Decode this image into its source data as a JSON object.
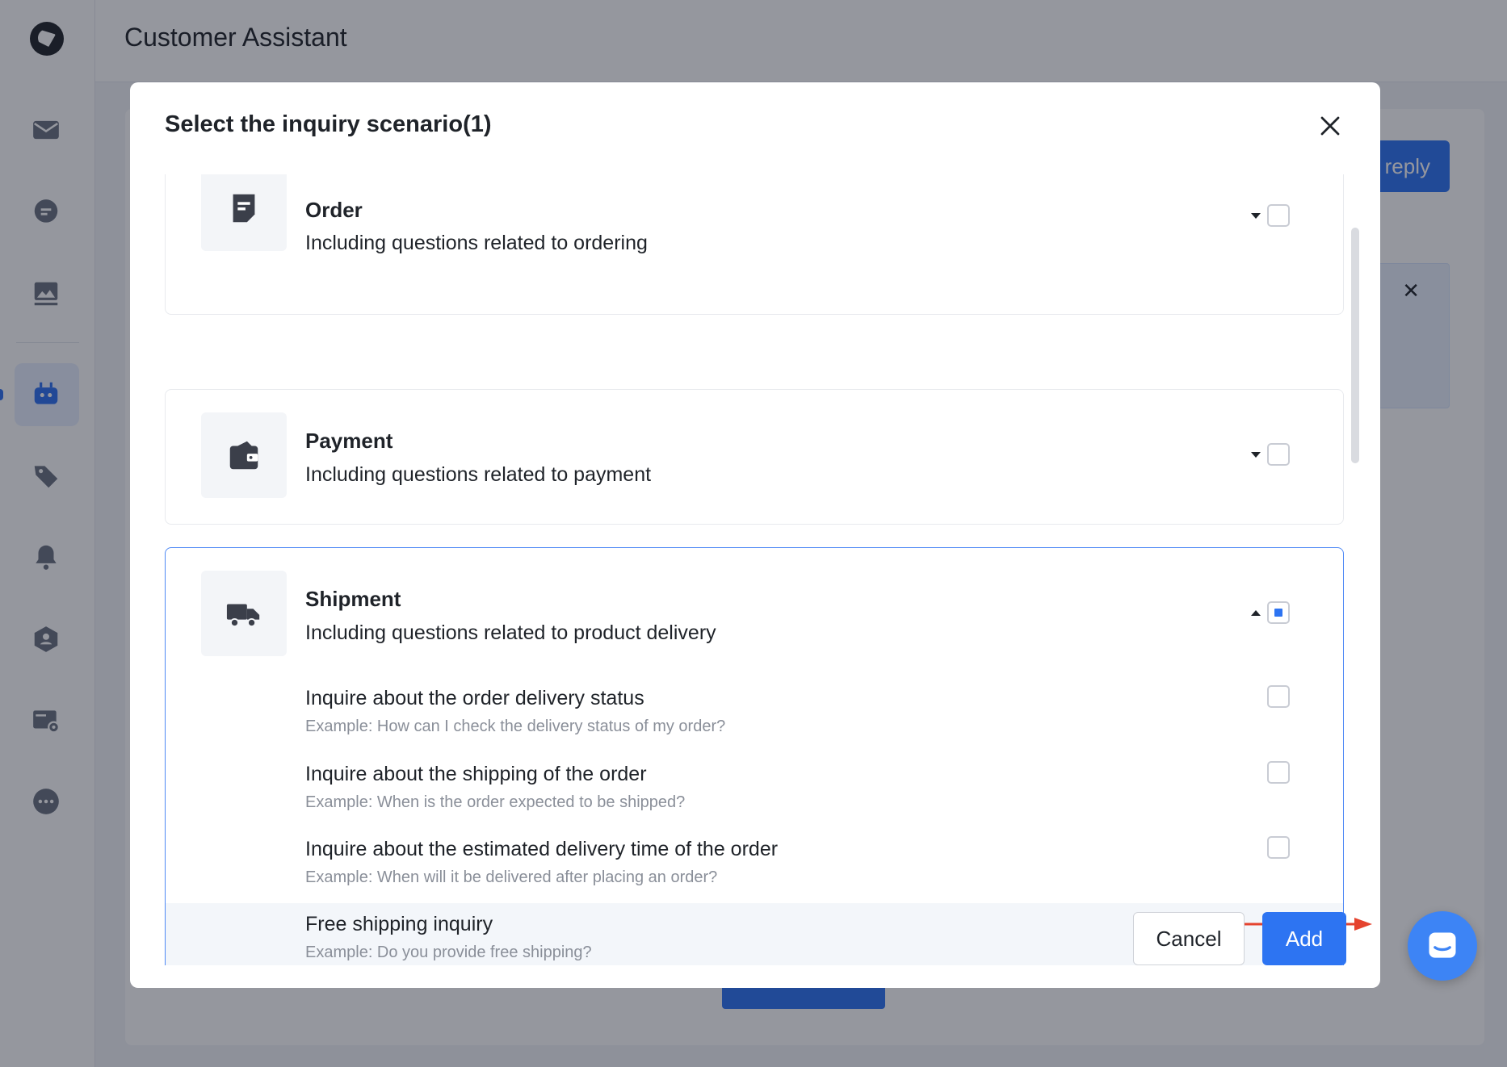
{
  "app": {
    "title": "Customer Assistant",
    "background_reply_label": "reply"
  },
  "sidebar": {
    "items": [
      {
        "icon": "mail-icon"
      },
      {
        "icon": "chat-icon"
      },
      {
        "icon": "image-icon"
      },
      {
        "icon": "robot-icon",
        "active": true
      },
      {
        "icon": "tag-icon"
      },
      {
        "icon": "bell-icon"
      },
      {
        "icon": "user-shield-icon"
      },
      {
        "icon": "card-settings-icon"
      },
      {
        "icon": "more-icon"
      }
    ]
  },
  "modal": {
    "title": "Select the inquiry scenario(1)",
    "categories": [
      {
        "title": "Order",
        "description": "Including questions related to ordering",
        "icon": "document-icon",
        "expanded": false,
        "state": "unchecked"
      },
      {
        "title": "Payment",
        "description": "Including questions related to payment",
        "icon": "wallet-icon",
        "expanded": false,
        "state": "unchecked"
      },
      {
        "title": "Shipment",
        "description": "Including questions related to product delivery",
        "icon": "truck-icon",
        "expanded": true,
        "state": "indeterminate",
        "items": [
          {
            "title": "Inquire about the order delivery status",
            "example": "Example: How can I check the delivery status of my order?",
            "checked": false
          },
          {
            "title": "Inquire about the shipping of the order",
            "example": "Example: When is the order expected to be shipped?",
            "checked": false
          },
          {
            "title": "Inquire about the estimated delivery time of the order",
            "example": "Example: When will it be delivered after placing an order?",
            "checked": false
          },
          {
            "title": "Free shipping inquiry",
            "example": "Example: Do you provide free shipping?",
            "checked": true
          }
        ]
      }
    ],
    "cancel_label": "Cancel",
    "add_label": "Add"
  },
  "colors": {
    "primary": "#2d74f2",
    "annotation_arrow": "#e5432e"
  }
}
